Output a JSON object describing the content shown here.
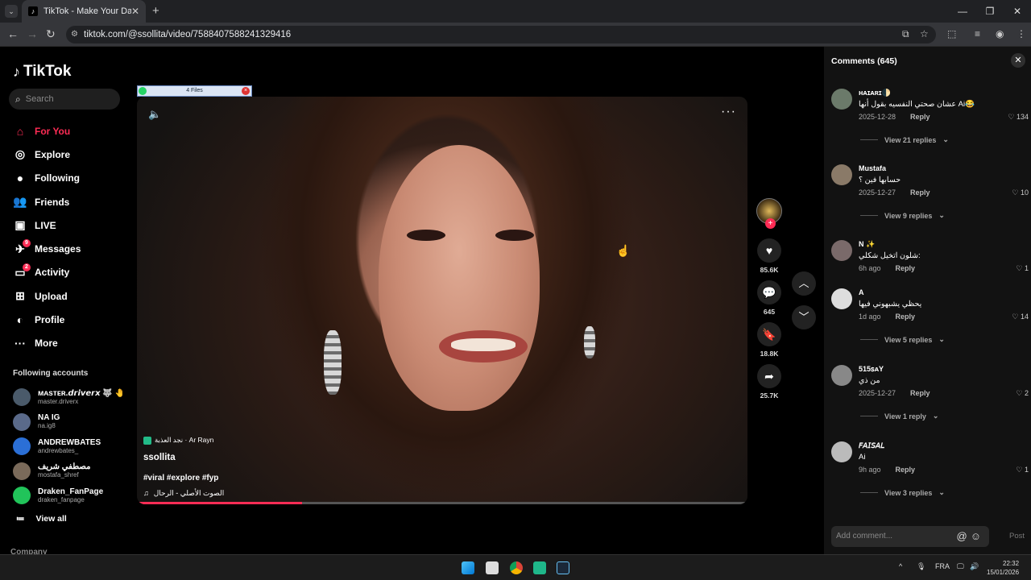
{
  "browser": {
    "tab_title": "TikTok - Make Your Day",
    "tab_close": "✕",
    "new_tab": "+",
    "url": "tiktok.com/@ssollita/video/7588407588241329416",
    "win_min": "—",
    "win_max": "❐",
    "win_close": "✕"
  },
  "sidebar": {
    "logo": "TikTok",
    "search_placeholder": "Search",
    "menu": [
      {
        "label": "For You",
        "icon": "home-icon",
        "glyph": "⌂",
        "active": true
      },
      {
        "label": "Explore",
        "icon": "compass-icon",
        "glyph": "◎"
      },
      {
        "label": "Following",
        "icon": "following-avatar-icon",
        "glyph": "●"
      },
      {
        "label": "Friends",
        "icon": "friends-icon",
        "glyph": "👥"
      },
      {
        "label": "LIVE",
        "icon": "live-icon",
        "glyph": "▣"
      },
      {
        "label": "Messages",
        "icon": "messages-icon",
        "glyph": "✈",
        "badge": "9"
      },
      {
        "label": "Activity",
        "icon": "activity-icon",
        "glyph": "▭",
        "badge": "2"
      },
      {
        "label": "Upload",
        "icon": "upload-icon",
        "glyph": "⊞"
      },
      {
        "label": "Profile",
        "icon": "profile-icon",
        "glyph": "◐"
      },
      {
        "label": "More",
        "icon": "more-icon",
        "glyph": "···"
      }
    ],
    "following_title": "Following accounts",
    "following": [
      {
        "name": "ᴍᴀsᴛᴇʀ.𝙙𝙧𝙞𝙫𝙚𝙧𝙭 🐺 🤚",
        "handle": "master.driverx",
        "color": "#4a5a6a"
      },
      {
        "name": "NA IG",
        "handle": "na.ig8",
        "color": "#5a6a8a"
      },
      {
        "name": "ANDREWBATES",
        "handle": "andrewbates_",
        "color": "#2b6fd6"
      },
      {
        "name": "مصطفي شريف",
        "handle": "mostafa_shref",
        "color": "#7a6a5a"
      },
      {
        "name": "Draken_FanPage",
        "handle": "draken_fanpage",
        "color": "#21c45a"
      }
    ],
    "view_all": "View all",
    "company": "Company"
  },
  "video": {
    "files_bar": "4 Files",
    "music_tag": "نجد العذبة · Ar Rayn",
    "author": "ssollita",
    "tags": "#viral #explore #fyp",
    "sound": "الصوت الأصلي - الرحال",
    "progress": 0.27,
    "likes": "85.6K",
    "comments": "645",
    "saves": "18.8K",
    "shares": "25.7K"
  },
  "comments_panel": {
    "title": "Comments (645)",
    "items": [
      {
        "user": "ʜᴀɪᴀʀɪ🌓",
        "text": "عشان صحتي النفسيه بقول أنها Ai😂",
        "date": "2025-12-28",
        "reply": "Reply",
        "likes": "134",
        "replies": "View 21 replies",
        "av": "#6b7a6a"
      },
      {
        "user": "Mustafa",
        "text": "حسابها فين ؟",
        "date": "2025-12-27",
        "reply": "Reply",
        "likes": "10",
        "replies": "View 9 replies",
        "av": "#8a7a68"
      },
      {
        "user": "N ✨",
        "text": "شلون اتخيل شكلي:",
        "date": "6h ago",
        "reply": "Reply",
        "likes": "1",
        "replies": "",
        "av": "#7a6a6a"
      },
      {
        "user": "A",
        "text": "يحظي يشبهوني فيها",
        "date": "1d ago",
        "reply": "Reply",
        "likes": "14",
        "replies": "View 5 replies",
        "av": "#ddd"
      },
      {
        "user": "515ꜱᴀY",
        "text": "من ذي",
        "date": "2025-12-27",
        "reply": "Reply",
        "likes": "2",
        "replies": "View 1 reply",
        "av": "#888"
      },
      {
        "user": "𝘍𝘈𝘐𝘚𝘈𝘓",
        "text": "Ai",
        "date": "9h ago",
        "reply": "Reply",
        "likes": "1",
        "replies": "View 3 replies",
        "av": "#bbb"
      }
    ],
    "input_placeholder": "Add comment...",
    "post": "Post"
  },
  "taskbar": {
    "lang": "FRA",
    "time": "22:32",
    "date": "15/01/2026"
  },
  "colors": {
    "accent": "#fe2c55"
  }
}
